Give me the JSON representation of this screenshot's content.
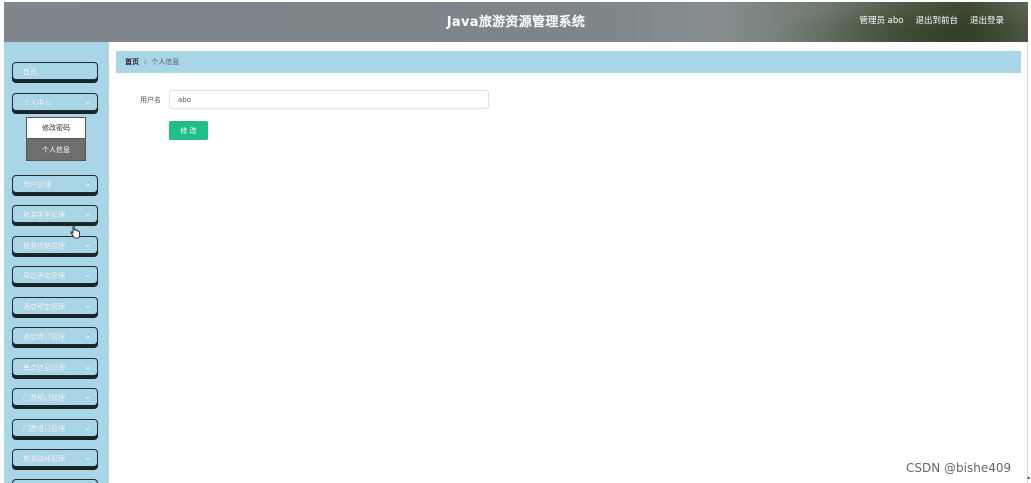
{
  "header": {
    "title": "Java旅游资源管理系统",
    "admin_label": "管理员 abo",
    "to_frontend": "退出到前台",
    "logout": "退出登录"
  },
  "sidebar": {
    "items": [
      {
        "label": "首页",
        "chevron": false
      },
      {
        "label": "个人中心",
        "chevron": true
      },
      {
        "label": "用户管理",
        "chevron": true
      },
      {
        "label": "旅游类型管理",
        "chevron": true
      },
      {
        "label": "旅游攻略管理",
        "chevron": true
      },
      {
        "label": "周边酒店管理",
        "chevron": true
      },
      {
        "label": "酒店预定管理",
        "chevron": true
      },
      {
        "label": "酒店退订管理",
        "chevron": true
      },
      {
        "label": "景点信息管理",
        "chevron": true
      },
      {
        "label": "门票预订管理",
        "chevron": true
      },
      {
        "label": "门票退订管理",
        "chevron": true
      },
      {
        "label": "旅游路线管理",
        "chevron": true
      }
    ],
    "submenu": [
      {
        "label": "修改密码",
        "active": false
      },
      {
        "label": "个人信息",
        "active": true
      }
    ]
  },
  "breadcrumb": {
    "home": "首页",
    "separator": "/",
    "current": "个人信息"
  },
  "form": {
    "username_label": "用户名",
    "username_value": "abo",
    "submit_label": "修 改"
  },
  "watermark": "CSDN @bishe409",
  "colors": {
    "sidebar_bg": "#a9d6e7",
    "accent_button": "#1fbe8a",
    "header_bg": "#7f878c"
  }
}
